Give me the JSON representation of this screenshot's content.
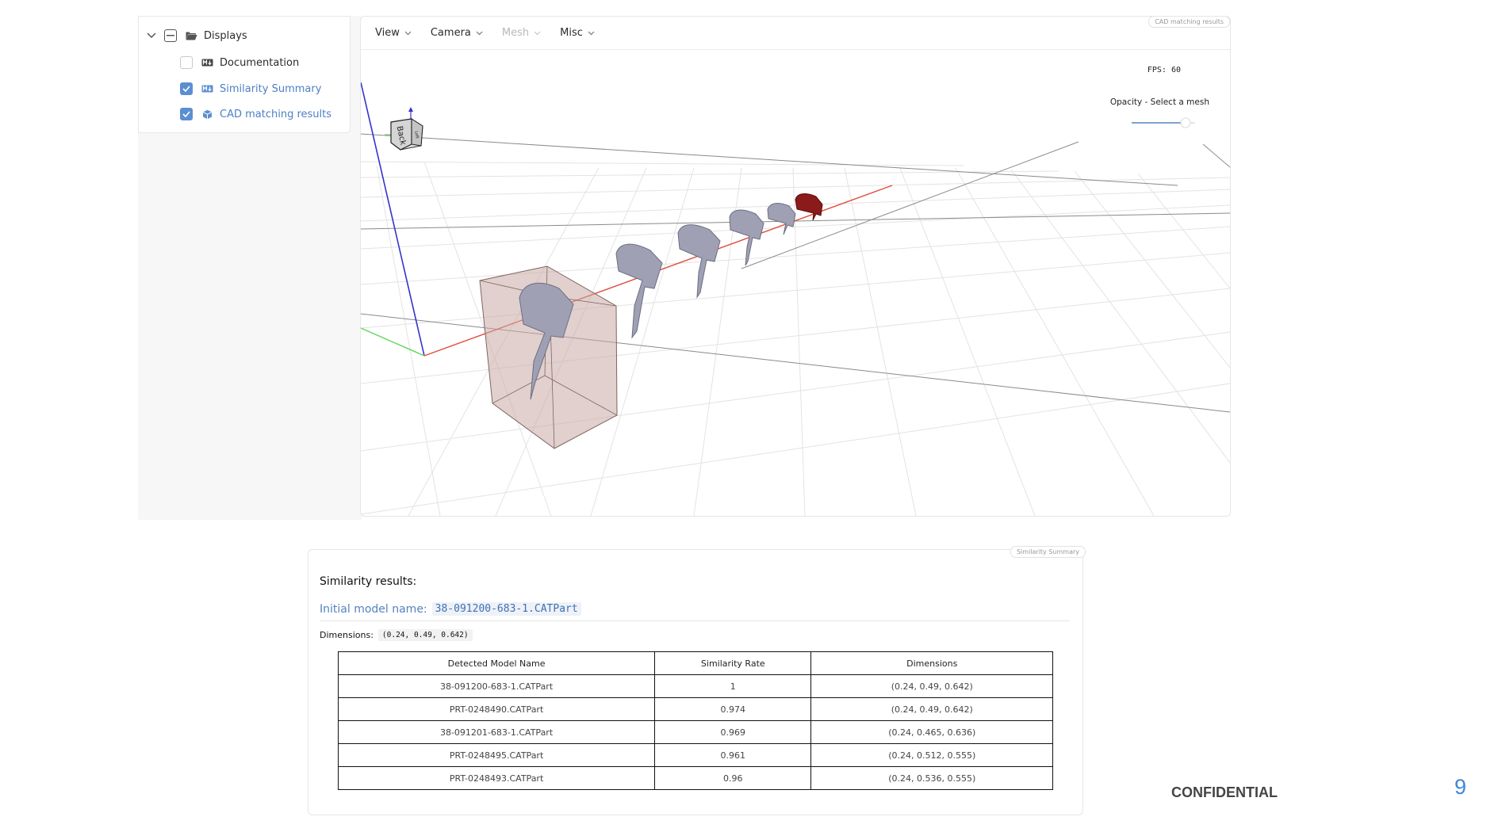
{
  "tree": {
    "root": {
      "label": "Displays"
    },
    "items": [
      {
        "label": "Documentation",
        "checked": false,
        "icon": "markdown-icon"
      },
      {
        "label": "Similarity Summary",
        "checked": true,
        "icon": "markdown-icon"
      },
      {
        "label": "CAD matching results",
        "checked": true,
        "icon": "cube-icon"
      }
    ]
  },
  "viewer": {
    "tag": "CAD matching results",
    "menus": [
      {
        "label": "View",
        "disabled": false
      },
      {
        "label": "Camera",
        "disabled": false
      },
      {
        "label": "Mesh",
        "disabled": true
      },
      {
        "label": "Misc",
        "disabled": false
      }
    ],
    "fps": "FPS: 60",
    "opacity_label": "Opacity - Select a mesh",
    "opacity_value": 0.85,
    "gizmo_face": "Back",
    "gizmo_side": "Left",
    "colors": {
      "x_axis": "#e04a3a",
      "y_axis": "#5dd65d",
      "z_axis": "#3333cc",
      "part": "#9c9cb0",
      "highlight_part": "#8b1a1a",
      "bbox": "#c9a9a4"
    }
  },
  "summary": {
    "tag": "Similarity Summary",
    "title": "Similarity results:",
    "initial_label": "Initial model name:",
    "initial_model": "38-091200-683-1.CATPart",
    "dimensions_label": "Dimensions:",
    "dimensions_value": "(0.24, 0.49, 0.642)",
    "table": {
      "headers": [
        "Detected Model Name",
        "Similarity Rate",
        "Dimensions"
      ],
      "rows": [
        [
          "38-091200-683-1.CATPart",
          "1",
          "(0.24, 0.49, 0.642)"
        ],
        [
          "PRT-0248490.CATPart",
          "0.974",
          "(0.24, 0.49, 0.642)"
        ],
        [
          "38-091201-683-1.CATPart",
          "0.969",
          "(0.24, 0.465, 0.636)"
        ],
        [
          "PRT-0248495.CATPart",
          "0.961",
          "(0.24, 0.512, 0.555)"
        ],
        [
          "PRT-0248493.CATPart",
          "0.96",
          "(0.24, 0.536, 0.555)"
        ]
      ]
    }
  },
  "footer": {
    "confidential": "CONFIDENTIAL",
    "page_number": "9"
  }
}
